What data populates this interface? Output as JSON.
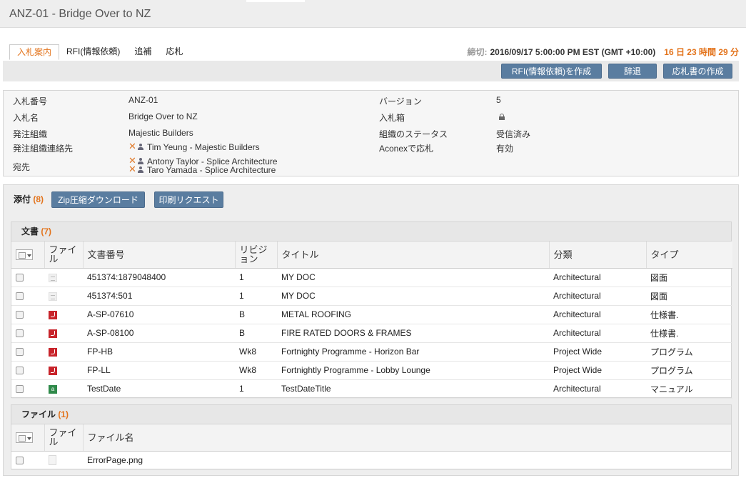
{
  "page": {
    "title": "ANZ-01 - Bridge Over to NZ"
  },
  "tabs": [
    {
      "label": "入札案内",
      "active": true
    },
    {
      "label": "RFI(情報依頼)"
    },
    {
      "label": "追補"
    },
    {
      "label": "応札"
    }
  ],
  "deadline": {
    "label": "締切:",
    "value": "2016/09/17 5:00:00 PM EST (GMT +10:00)",
    "remaining": "16 日 23 時間 29 分"
  },
  "actions": {
    "create_rfi": "RFI(情報依頼)を作成",
    "decline": "辞退",
    "create_response": "応札書の作成"
  },
  "info": {
    "tender_no_label": "入札番号",
    "tender_no": "ANZ-01",
    "tender_name_label": "入札名",
    "tender_name": "Bridge Over to NZ",
    "issuer_label": "発注組織",
    "issuer": "Majestic Builders",
    "issuer_contact_label": "発注組織連絡先",
    "issuer_contact": "Tim Yeung - Majestic Builders",
    "to_label": "宛先",
    "to": [
      "Antony Taylor - Splice Architecture",
      "Taro Yamada - Splice Architecture"
    ],
    "version_label": "バージョン",
    "version": "5",
    "box_label": "入札箱",
    "org_status_label": "組織のステータス",
    "org_status": "受信済み",
    "aconex_label": "Aconexで応札",
    "aconex": "有効"
  },
  "attachments": {
    "label": "添付",
    "count": "(8)",
    "zip_button": "Zip圧縮ダウンロード",
    "print_button": "印刷リクエスト"
  },
  "documents": {
    "label": "文書",
    "count": "(7)",
    "headers": {
      "file": "ファイル",
      "doc_no": "文書番号",
      "revision": "リビジョン",
      "title": "タイトル",
      "category": "分類",
      "type": "タイプ"
    },
    "rows": [
      {
        "icon": "doc-file-icon",
        "doc_no": "451374:1879048400",
        "rev": "1",
        "title": "MY DOC",
        "category": "Architectural",
        "type": "図面"
      },
      {
        "icon": "doc-file-icon",
        "doc_no": "451374:501",
        "rev": "1",
        "title": "MY DOC",
        "category": "Architectural",
        "type": "図面"
      },
      {
        "icon": "pdf-file-icon",
        "doc_no": "A-SP-07610",
        "rev": "B",
        "title": "METAL ROOFING",
        "category": "Architectural",
        "type": "仕様書."
      },
      {
        "icon": "pdf-file-icon",
        "doc_no": "A-SP-08100",
        "rev": "B",
        "title": "FIRE RATED DOORS & FRAMES",
        "category": "Architectural",
        "type": "仕様書."
      },
      {
        "icon": "pdf-file-icon",
        "doc_no": "FP-HB",
        "rev": "Wk8",
        "title": "Fortnighty Programme - Horizon Bar",
        "category": "Project Wide",
        "type": "プログラム"
      },
      {
        "icon": "pdf-file-icon",
        "doc_no": "FP-LL",
        "rev": "Wk8",
        "title": "Fortnightly Programme - Lobby Lounge",
        "category": "Project Wide",
        "type": "プログラム"
      },
      {
        "icon": "spreadsheet-file-icon",
        "doc_no": "TestDate",
        "rev": "1",
        "title": "TestDateTitle",
        "category": "Architectural",
        "type": "マニュアル"
      }
    ]
  },
  "files": {
    "label": "ファイル",
    "count": "(1)",
    "headers": {
      "file": "ファイル",
      "name": "ファイル名"
    },
    "rows": [
      {
        "icon": "image-file-icon",
        "name": "ErrorPage.png"
      }
    ]
  },
  "colors": {
    "accent": "#e3731b",
    "button": "#5a7da0",
    "pdf": "#c8242b"
  }
}
